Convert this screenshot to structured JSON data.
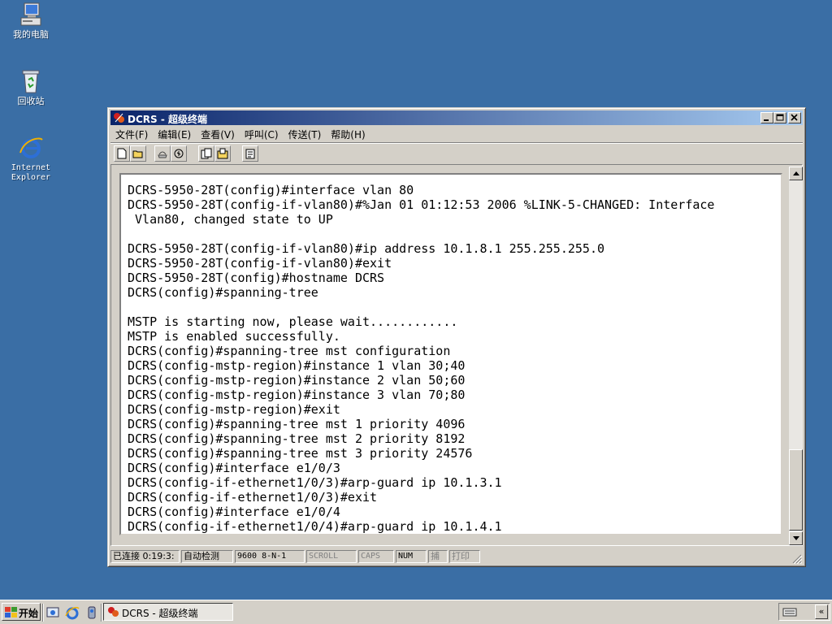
{
  "desktop": {
    "icons": [
      {
        "label": "我的电脑",
        "icon": "my-computer-icon"
      },
      {
        "label": "回收站",
        "icon": "recycle-bin-icon"
      },
      {
        "label": "Internet",
        "label2": "Explorer",
        "icon": "internet-explorer-icon"
      }
    ],
    "background": "#3a6ea5"
  },
  "window": {
    "title": "DCRS - 超级终端",
    "menu": [
      "文件(F)",
      "编辑(E)",
      "查看(V)",
      "呼叫(C)",
      "传送(T)",
      "帮助(H)"
    ],
    "toolbar": [
      "new-icon",
      "open-icon",
      "disconnect-icon",
      "dial-icon",
      "send-icon",
      "receive-icon",
      "properties-icon"
    ],
    "terminal_lines": [
      "DCRS-5950-28T(config)#interface vlan 80",
      "DCRS-5950-28T(config-if-vlan80)#%Jan 01 01:12:53 2006 %LINK-5-CHANGED: Interface",
      " Vlan80, changed state to UP",
      "",
      "DCRS-5950-28T(config-if-vlan80)#ip address 10.1.8.1 255.255.255.0",
      "DCRS-5950-28T(config-if-vlan80)#exit",
      "DCRS-5950-28T(config)#hostname DCRS",
      "DCRS(config)#spanning-tree",
      "",
      "MSTP is starting now, please wait............",
      "MSTP is enabled successfully.",
      "DCRS(config)#spanning-tree mst configuration",
      "DCRS(config-mstp-region)#instance 1 vlan 30;40",
      "DCRS(config-mstp-region)#instance 2 vlan 50;60",
      "DCRS(config-mstp-region)#instance 3 vlan 70;80",
      "DCRS(config-mstp-region)#exit",
      "DCRS(config)#spanning-tree mst 1 priority 4096",
      "DCRS(config)#spanning-tree mst 2 priority 8192",
      "DCRS(config)#spanning-tree mst 3 priority 24576",
      "DCRS(config)#interface e1/0/3",
      "DCRS(config-if-ethernet1/0/3)#arp-guard ip 10.1.3.1",
      "DCRS(config-if-ethernet1/0/3)#exit",
      "DCRS(config)#interface e1/0/4",
      "DCRS(config-if-ethernet1/0/4)#arp-guard ip 10.1.4.1"
    ],
    "status": {
      "connected": "已连接 0:19:3:",
      "detect": "自动检测",
      "params": "9600 8-N-1",
      "scroll": "SCROLL",
      "caps": "CAPS",
      "num": "NUM",
      "capture": "捕",
      "print": "打印"
    }
  },
  "taskbar": {
    "start": "开始",
    "task": "DCRS - 超级终端",
    "quicklaunch": [
      "show-desktop-icon",
      "internet-explorer-icon",
      "windows-media-icon"
    ],
    "tray": [
      "keyboard-icon",
      "chevron-left-icon"
    ]
  },
  "colors": {
    "desktop": "#3a6ea5",
    "title_active_start": "#0a246a",
    "title_active_end": "#a6caf0",
    "face": "#d4d0c8"
  }
}
